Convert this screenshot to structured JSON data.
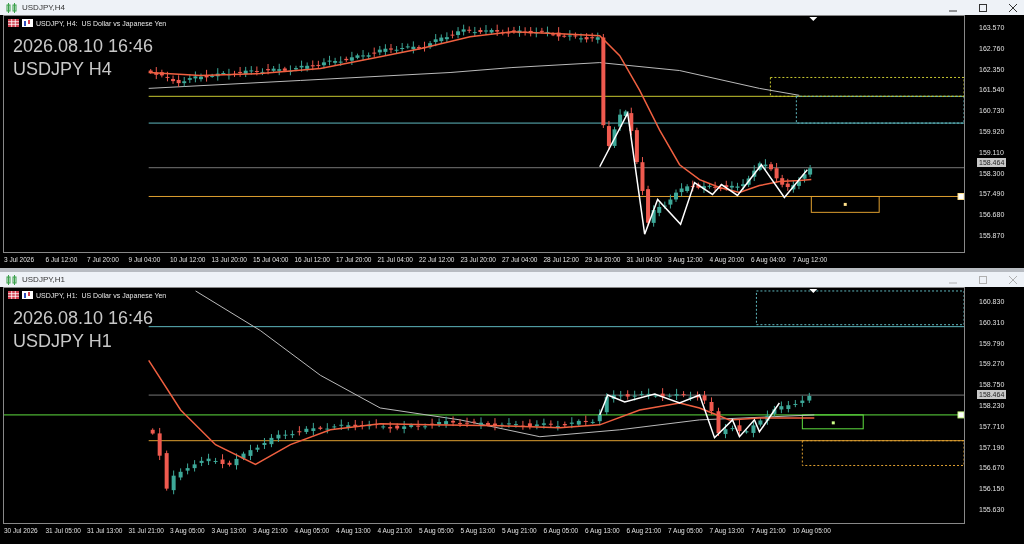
{
  "windows": [
    {
      "title": "USDJPY,H4",
      "active": true,
      "chart": {
        "header": "USDJPY, H4:  US Dollar vs Japanese Yen",
        "date_overlay": "2026.08.10 16:46",
        "symbol_overlay": "USDJPY H4",
        "current_price": "158.464",
        "price_ticks": [
          "163.570",
          "162.760",
          "162.350",
          "161.540",
          "160.730",
          "159.920",
          "159.110",
          "158.300",
          "157.490",
          "156.680",
          "155.870"
        ],
        "time_labels": [
          "3 Jul 2026",
          "6 Jul 12:00",
          "7 Jul 20:00",
          "9 Jul 04:00",
          "10 Jul 12:00",
          "13 Jul 20:00",
          "15 Jul 04:00",
          "16 Jul 12:00",
          "17 Jul 20:00",
          "21 Jul 04:00",
          "22 Jul 12:00",
          "23 Jul 20:00",
          "27 Jul 04:00",
          "28 Jul 12:00",
          "29 Jul 20:00",
          "31 Jul 04:00",
          "3 Aug 12:00",
          "4 Aug 20:00",
          "6 Aug 04:00",
          "7 Aug 12:00"
        ]
      }
    },
    {
      "title": "USDJPY,H1",
      "active": false,
      "chart": {
        "header": "USDJPY, H1:  US Dollar vs Japanese Yen",
        "date_overlay": "2026.08.10 16:46",
        "symbol_overlay": "USDJPY H1",
        "current_price": "158.464",
        "price_ticks": [
          "160.830",
          "160.310",
          "159.790",
          "159.270",
          "158.750",
          "158.230",
          "157.710",
          "157.190",
          "156.670",
          "156.150",
          "155.630"
        ],
        "time_labels": [
          "30 Jul 2026",
          "31 Jul 05:00",
          "31 Jul 13:00",
          "31 Jul 21:00",
          "3 Aug 05:00",
          "3 Aug 13:00",
          "3 Aug 21:00",
          "4 Aug 05:00",
          "4 Aug 13:00",
          "4 Aug 21:00",
          "5 Aug 05:00",
          "5 Aug 13:00",
          "5 Aug 21:00",
          "6 Aug 05:00",
          "6 Aug 13:00",
          "6 Aug 21:00",
          "7 Aug 05:00",
          "7 Aug 13:00",
          "7 Aug 21:00",
          "10 Aug 05:00"
        ]
      }
    }
  ]
}
